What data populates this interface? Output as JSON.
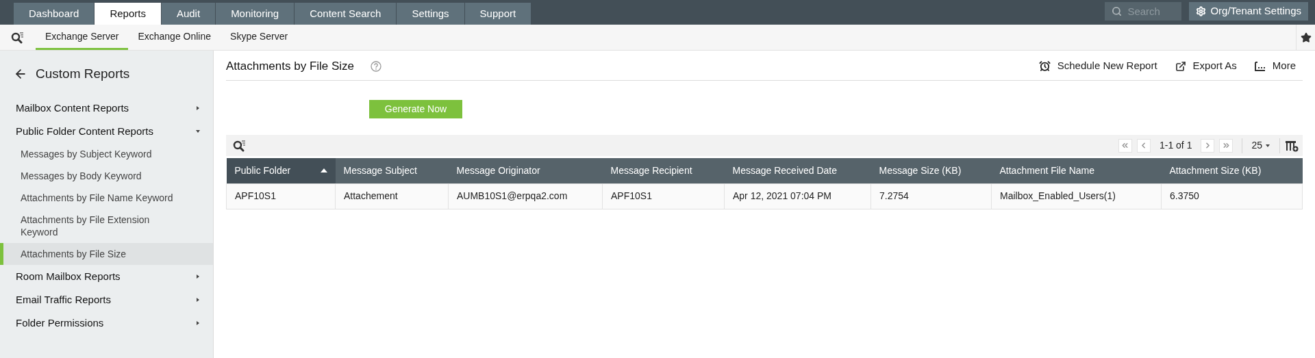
{
  "top_tabs": [
    {
      "label": "Dashboard",
      "selected": false
    },
    {
      "label": "Reports",
      "selected": true
    },
    {
      "label": "Audit",
      "selected": false
    },
    {
      "label": "Monitoring",
      "selected": false
    },
    {
      "label": "Content Search",
      "selected": false
    },
    {
      "label": "Settings",
      "selected": false
    },
    {
      "label": "Support",
      "selected": false
    }
  ],
  "search": {
    "placeholder": "Search"
  },
  "settings_button": "Org/Tenant Settings",
  "sub_tabs": [
    {
      "label": "Exchange Server",
      "selected": true
    },
    {
      "label": "Exchange Online",
      "selected": false
    },
    {
      "label": "Skype Server",
      "selected": false
    }
  ],
  "sidebar": {
    "title": "Custom Reports",
    "items": [
      {
        "label": "Mailbox Content Reports",
        "expanded": false
      },
      {
        "label": "Public Folder Content Reports",
        "expanded": true,
        "children": [
          {
            "label": "Messages by Subject Keyword",
            "selected": false
          },
          {
            "label": "Messages by Body Keyword",
            "selected": false
          },
          {
            "label": "Attachments by File Name Keyword",
            "selected": false
          },
          {
            "label": "Attachments by File Extension Keyword",
            "selected": false
          },
          {
            "label": "Attachments by File Size",
            "selected": true
          }
        ]
      },
      {
        "label": "Room Mailbox Reports",
        "expanded": false
      },
      {
        "label": "Email Traffic Reports",
        "expanded": false
      },
      {
        "label": "Folder Permissions",
        "expanded": false
      }
    ]
  },
  "report": {
    "title": "Attachments by File Size",
    "actions": [
      {
        "kind": "schedule",
        "label": "Schedule New Report"
      },
      {
        "kind": "export",
        "label": "Export As"
      },
      {
        "kind": "more",
        "label": "More"
      }
    ],
    "generate_button": "Generate Now",
    "pagination": {
      "range": "1-1 of 1",
      "page_size": "25"
    },
    "table": {
      "columns": [
        {
          "label": "Public Folder",
          "sorted": true
        },
        {
          "label": "Message Subject",
          "sorted": false
        },
        {
          "label": "Message Originator",
          "sorted": false
        },
        {
          "label": "Message Recipient",
          "sorted": false
        },
        {
          "label": "Message Received Date",
          "sorted": false
        },
        {
          "label": "Message Size (KB)",
          "sorted": false
        },
        {
          "label": "Attachment File Name",
          "sorted": false
        },
        {
          "label": "Attachment Size (KB)",
          "sorted": false
        }
      ],
      "rows": [
        [
          "APF10S1",
          "Attachement",
          "AUMB10S1@erpqa2.com",
          "APF10S1",
          "Apr 12, 2021 07:04 PM",
          "7.2754",
          "Mailbox_Enabled_Users(1)",
          "6.3750"
        ]
      ]
    }
  }
}
